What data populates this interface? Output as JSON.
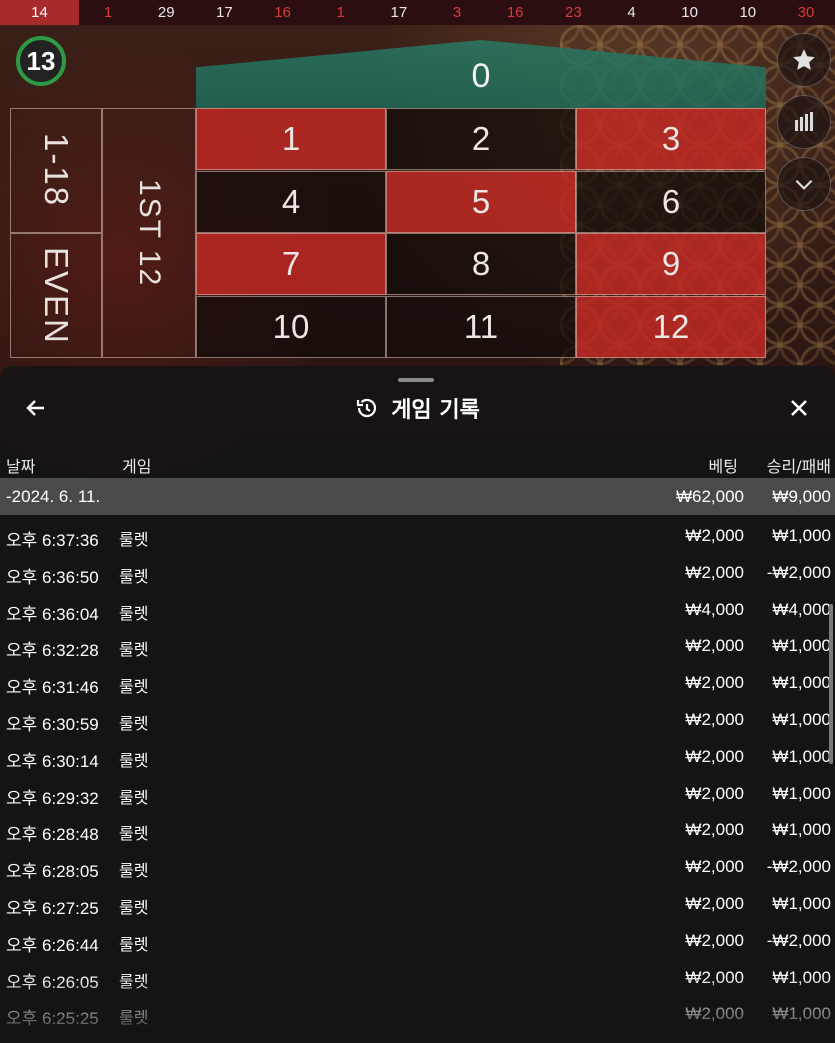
{
  "recent_results": [
    {
      "n": "14",
      "c": "red"
    },
    {
      "n": "1",
      "c": "red"
    },
    {
      "n": "29",
      "c": "black"
    },
    {
      "n": "17",
      "c": "black"
    },
    {
      "n": "16",
      "c": "red"
    },
    {
      "n": "1",
      "c": "red"
    },
    {
      "n": "17",
      "c": "black"
    },
    {
      "n": "3",
      "c": "red"
    },
    {
      "n": "16",
      "c": "red"
    },
    {
      "n": "23",
      "c": "red"
    },
    {
      "n": "4",
      "c": "black"
    },
    {
      "n": "10",
      "c": "black"
    },
    {
      "n": "10",
      "c": "black"
    },
    {
      "n": "30",
      "c": "red"
    }
  ],
  "timer": "13",
  "board": {
    "zero": "0",
    "rows": [
      [
        {
          "n": "1",
          "c": "red"
        },
        {
          "n": "2",
          "c": "black"
        },
        {
          "n": "3",
          "c": "red"
        }
      ],
      [
        {
          "n": "4",
          "c": "black"
        },
        {
          "n": "5",
          "c": "red"
        },
        {
          "n": "6",
          "c": "black"
        }
      ],
      [
        {
          "n": "7",
          "c": "red"
        },
        {
          "n": "8",
          "c": "black"
        },
        {
          "n": "9",
          "c": "red"
        }
      ],
      [
        {
          "n": "10",
          "c": "black"
        },
        {
          "n": "11",
          "c": "black"
        },
        {
          "n": "12",
          "c": "red"
        }
      ]
    ],
    "low_label": "1-18",
    "even_label": "EVEN",
    "dozen_label": "1ST 12"
  },
  "modal": {
    "title": "게임 기록",
    "icons": {
      "back": "arrow-left-icon",
      "history": "history-icon",
      "close": "close-icon"
    },
    "columns": {
      "date": "날짜",
      "game": "게임",
      "bet": "베팅",
      "win": "승리/패배"
    },
    "day_summary": {
      "date": "-2024. 6. 11.",
      "bet": "₩62,000",
      "win": "₩9,000"
    },
    "rows": [
      {
        "time": "오후 6:37:36",
        "game": "룰렛",
        "bet": "₩2,000",
        "win": "₩1,000"
      },
      {
        "time": "오후 6:36:50",
        "game": "룰렛",
        "bet": "₩2,000",
        "win": "-₩2,000"
      },
      {
        "time": "오후 6:36:04",
        "game": "룰렛",
        "bet": "₩4,000",
        "win": "₩4,000"
      },
      {
        "time": "오후 6:32:28",
        "game": "룰렛",
        "bet": "₩2,000",
        "win": "₩1,000"
      },
      {
        "time": "오후 6:31:46",
        "game": "룰렛",
        "bet": "₩2,000",
        "win": "₩1,000"
      },
      {
        "time": "오후 6:30:59",
        "game": "룰렛",
        "bet": "₩2,000",
        "win": "₩1,000"
      },
      {
        "time": "오후 6:30:14",
        "game": "룰렛",
        "bet": "₩2,000",
        "win": "₩1,000"
      },
      {
        "time": "오후 6:29:32",
        "game": "룰렛",
        "bet": "₩2,000",
        "win": "₩1,000"
      },
      {
        "time": "오후 6:28:48",
        "game": "룰렛",
        "bet": "₩2,000",
        "win": "₩1,000"
      },
      {
        "time": "오후 6:28:05",
        "game": "룰렛",
        "bet": "₩2,000",
        "win": "-₩2,000"
      },
      {
        "time": "오후 6:27:25",
        "game": "룰렛",
        "bet": "₩2,000",
        "win": "₩1,000"
      },
      {
        "time": "오후 6:26:44",
        "game": "룰렛",
        "bet": "₩2,000",
        "win": "-₩2,000"
      },
      {
        "time": "오후 6:26:05",
        "game": "룰렛",
        "bet": "₩2,000",
        "win": "₩1,000"
      },
      {
        "time": "오후 6:25:25",
        "game": "룰렛",
        "bet": "₩2,000",
        "win": "₩1,000"
      }
    ]
  }
}
